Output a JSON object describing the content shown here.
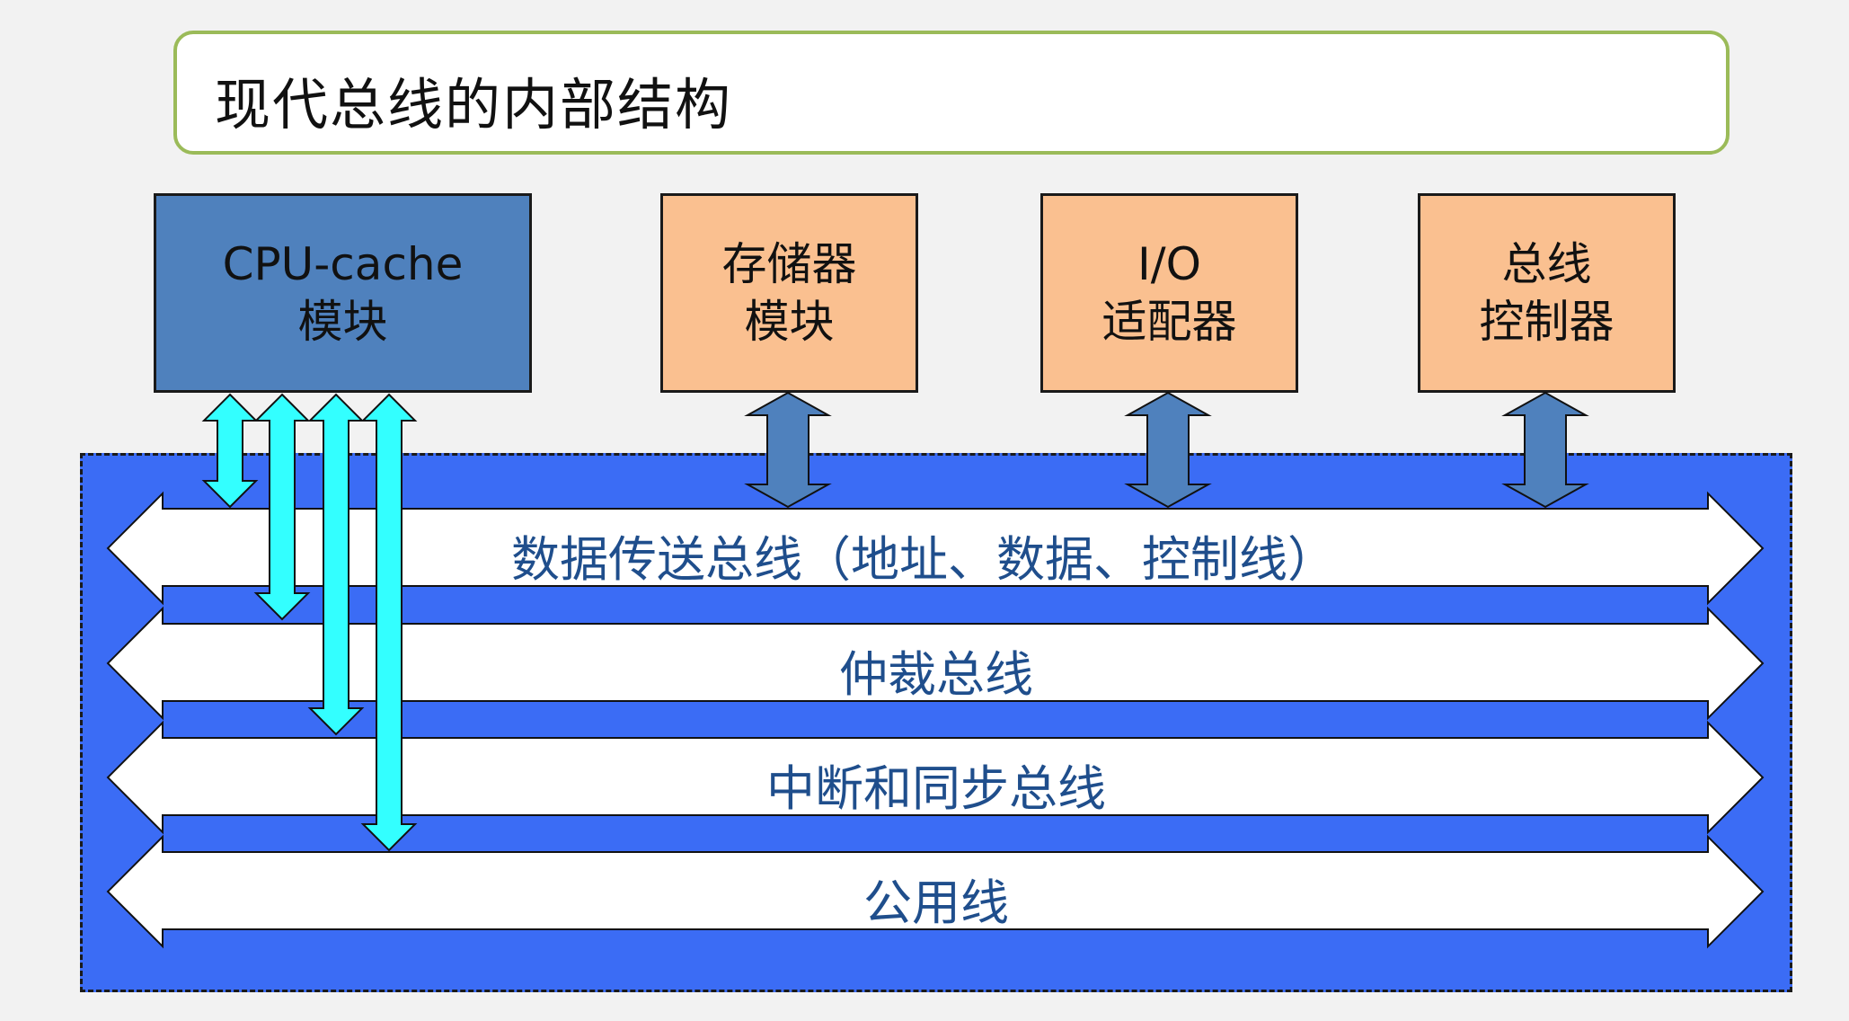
{
  "title": "现代总线的内部结构",
  "modules": {
    "cpu": {
      "line1": "CPU-cache",
      "line2": "模块"
    },
    "memory": {
      "line1": "存储器",
      "line2": "模块"
    },
    "io": {
      "line1": "I/O",
      "line2": "适配器"
    },
    "controller": {
      "line1": "总线",
      "line2": "控制器"
    }
  },
  "buses": [
    {
      "label": "数据传送总线（地址、数据、控制线）"
    },
    {
      "label": "仲裁总线"
    },
    {
      "label": "中断和同步总线"
    },
    {
      "label": "公用线"
    }
  ],
  "colors": {
    "title_border": "#9bbb59",
    "cpu_module": "#4f81bd",
    "peripheral_module": "#fac090",
    "bus_region": "#3b6cf5",
    "bus_arrow": "#ffffff",
    "cpu_connector": "#33ffff",
    "module_connector": "#4f81bd",
    "bus_label": "#1f4e8c"
  }
}
